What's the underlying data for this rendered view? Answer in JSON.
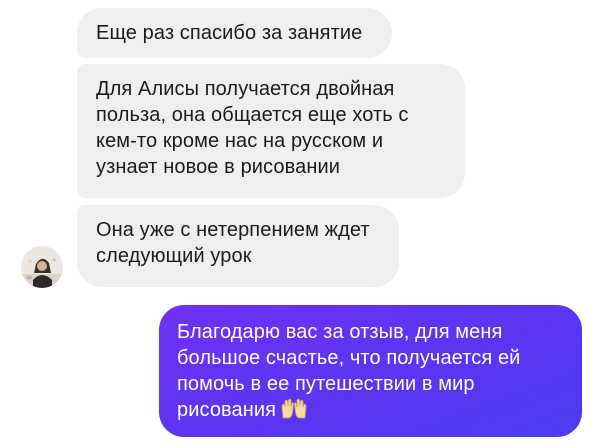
{
  "messages": {
    "incoming": [
      {
        "lines": [
          "Еще раз спасибо за занятие"
        ]
      },
      {
        "lines": [
          "Для Алисы получается двойная",
          "польза, она общается еще хоть с",
          "кем-то кроме нас на русском и",
          "узнает новое в рисовании"
        ]
      },
      {
        "lines": [
          "Она уже с нетерпением ждет",
          "следующий урок"
        ]
      }
    ],
    "outgoing": {
      "lines": [
        "Благодарю вас за отзыв, для меня",
        "большое счастье, что получается ей",
        "помочь в ее путешествии в мир",
        "рисования"
      ],
      "emoji": "raising-hands-icon"
    }
  },
  "colors": {
    "incoming_bubble": "#efeff1",
    "outgoing_bubble": "#5b34f2",
    "outgoing_text": "#ffffff"
  }
}
